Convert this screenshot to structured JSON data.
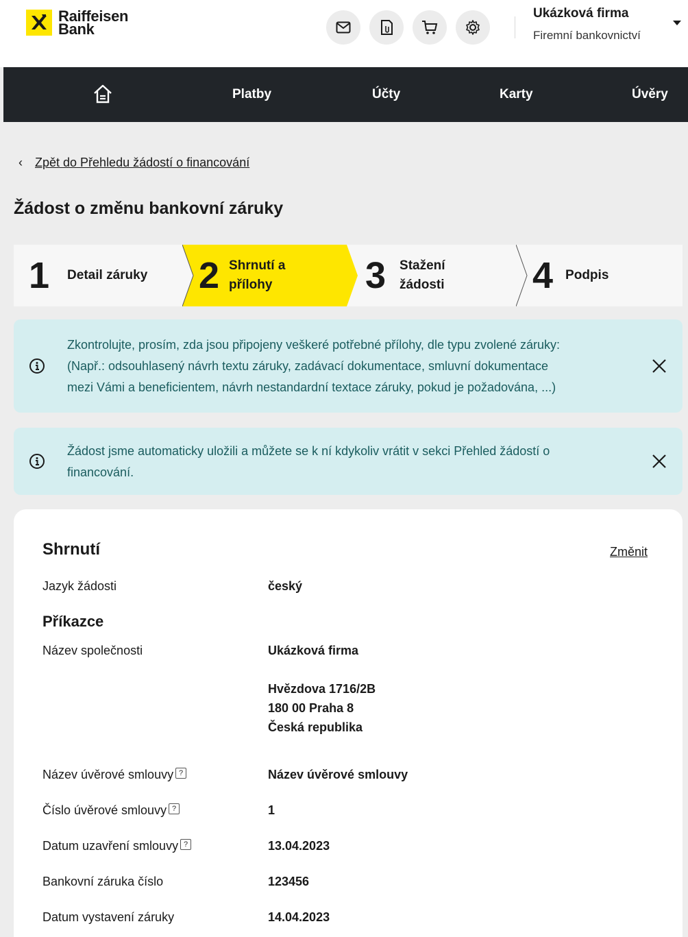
{
  "brand": {
    "line1": "Raiffeisen",
    "line2": "Bank",
    "color": "#fee600"
  },
  "header": {
    "icons": [
      "mail-icon",
      "document-icon",
      "cart-icon",
      "settings-icon"
    ],
    "user_name": "Ukázková firma",
    "user_sub": "Firemní bankovnictví"
  },
  "nav": {
    "home_icon": "home-icon",
    "items": [
      "Platby",
      "Účty",
      "Karty",
      "Úvěry"
    ]
  },
  "back_link": "Zpět do Přehledu žádostí o financování",
  "page_title": "Žádost o změnu bankovní záruky",
  "steps": [
    {
      "num": "1",
      "label": "Detail záruky"
    },
    {
      "num": "2",
      "label_line1": "Shrnutí a",
      "label_line2": "přílohy",
      "active": true
    },
    {
      "num": "3",
      "label_line1": "Stažení",
      "label_line2": "žádosti"
    },
    {
      "num": "4",
      "label": "Podpis"
    }
  ],
  "alerts": [
    {
      "line1": "Zkontrolujte, prosím, zda jsou připojeny veškeré potřebné přílohy, dle typu zvolené záruky:",
      "line2": "(Např.: odsouhlasený návrh textu záruky, zadávací dokumentace, smluvní dokumentace",
      "line3": "mezi Vámi a beneficientem, návrh nestandardní textace záruky, pokud je požadována, ...)"
    },
    {
      "line1": "Žádost jsme automaticky uložili a můžete se k ní kdykoliv vrátit v sekci  Přehled žádostí o",
      "line2": "financování."
    }
  ],
  "summary": {
    "title": "Shrnutí",
    "change": "Změnit",
    "language_label": "Jazyk žádosti",
    "language_value": "český",
    "section_principal": "Příkazce",
    "company_label": "Název společnosti",
    "company_value": "Ukázková firma",
    "address": [
      "Hvězdova  1716/2B",
      "180 00  Praha 8",
      "Česká republika"
    ],
    "rows": [
      {
        "label": "Název úvěrové smlouvy",
        "value": "Název úvěrové smlouvy",
        "help": "?"
      },
      {
        "label": "Číslo úvěrové smlouvy",
        "value": "1",
        "help": "?"
      },
      {
        "label": "Datum uzavření smlouvy",
        "value": "13.04.2023",
        "help": "?"
      },
      {
        "label": "Bankovní záruka číslo",
        "value": "123456"
      },
      {
        "label": "Datum vystavení záruky",
        "value": "14.04.2023"
      }
    ]
  },
  "colors": {
    "nav_bg": "#212529",
    "alert_bg": "#d5eef0",
    "active_step": "#fee600",
    "page_bg": "#ededed"
  }
}
